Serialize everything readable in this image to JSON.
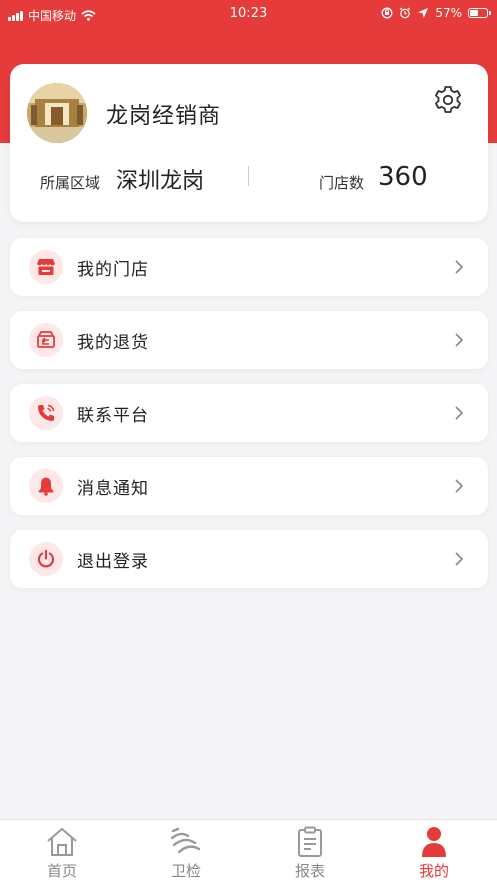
{
  "status_bar": {
    "carrier": "中国移动",
    "time": "10:23",
    "battery_text": "57%",
    "battery_level": 0.57
  },
  "profile": {
    "store_name": "龙岗经销商",
    "region_label": "所属区域",
    "region_value": "深圳龙岗",
    "stores_label": "门店数",
    "stores_value": "360"
  },
  "menu": {
    "items": [
      {
        "label": "我的门店",
        "icon": "store-icon"
      },
      {
        "label": "我的退货",
        "icon": "return-icon"
      },
      {
        "label": "联系平台",
        "icon": "phone-icon"
      },
      {
        "label": "消息通知",
        "icon": "bell-icon"
      },
      {
        "label": "退出登录",
        "icon": "power-icon"
      }
    ]
  },
  "tabs": [
    {
      "label": "首页",
      "icon": "home-icon",
      "active": false
    },
    {
      "label": "卫检",
      "icon": "signal-icon",
      "active": false
    },
    {
      "label": "报表",
      "icon": "clipboard-icon",
      "active": false
    },
    {
      "label": "我的",
      "icon": "user-icon",
      "active": true
    }
  ],
  "colors": {
    "accent": "#e63b3b",
    "icon_bg": "#fde7e7",
    "background": "#f4f4f6",
    "tab_inactive": "#888888"
  }
}
